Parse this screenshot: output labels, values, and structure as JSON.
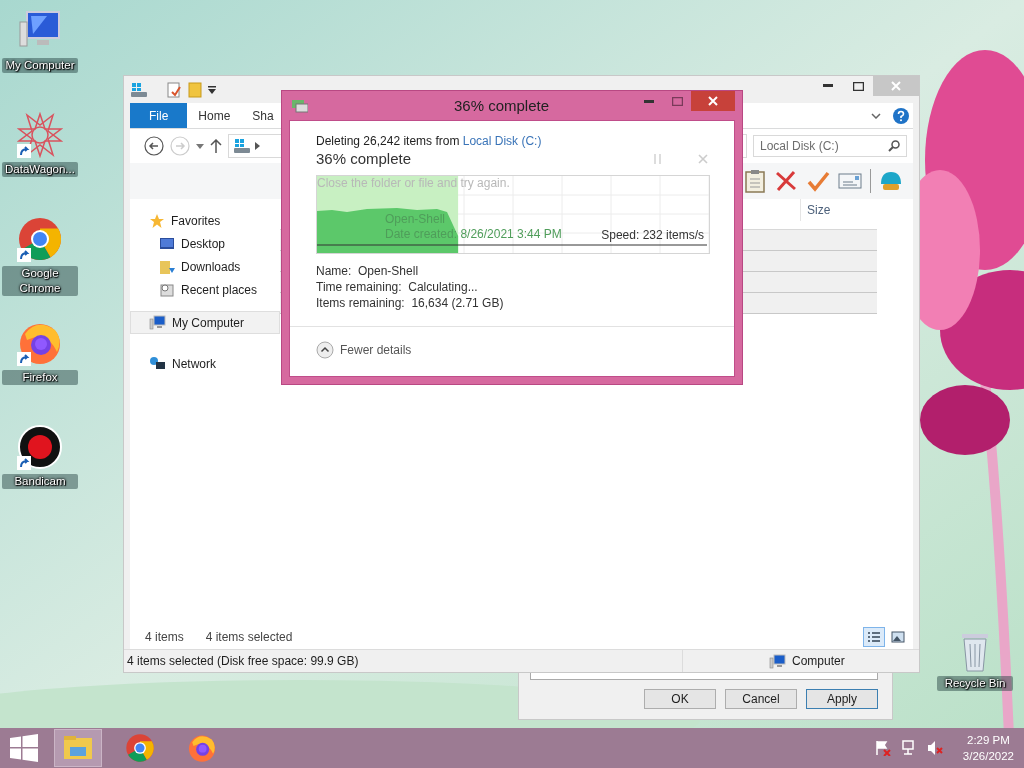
{
  "desktop_icons": [
    {
      "label": "My Computer",
      "kind": "computer",
      "shortcut": false
    },
    {
      "label": "DataWagon...",
      "kind": "star",
      "shortcut": true
    },
    {
      "label": "Google Chrome",
      "kind": "chrome",
      "shortcut": true
    },
    {
      "label": "Firefox",
      "kind": "firefox",
      "shortcut": true
    },
    {
      "label": "Bandicam",
      "kind": "record",
      "shortcut": true
    }
  ],
  "recycle_bin": {
    "label": "Recycle Bin"
  },
  "explorer": {
    "ribbon_tabs": [
      {
        "label": "File",
        "selected": true
      },
      {
        "label": "Home",
        "selected": false
      },
      {
        "label": "Sha",
        "selected": false
      }
    ],
    "search": {
      "placeholder": "Local Disk (C:)"
    },
    "nav": [
      {
        "label": "Favorites",
        "kind": "favorites",
        "selected": false,
        "children": [
          {
            "label": "Desktop",
            "kind": "desktop",
            "selected": false
          },
          {
            "label": "Downloads",
            "kind": "downloads",
            "selected": false
          },
          {
            "label": "Recent places",
            "kind": "recent",
            "selected": false
          }
        ]
      },
      {
        "label": "My Computer",
        "kind": "computer",
        "selected": true
      },
      {
        "label": "Network",
        "kind": "network",
        "selected": false
      }
    ],
    "columns": [
      "Size"
    ],
    "rows": [
      {
        "selected": true
      },
      {
        "selected": true
      },
      {
        "selected": true
      },
      {
        "selected": true
      }
    ],
    "footer": {
      "count": "4 items",
      "selection": "4 items selected"
    },
    "view_buttons": [
      {
        "kind": "details",
        "selected": true
      },
      {
        "kind": "tiles",
        "selected": false
      }
    ],
    "status_bar": {
      "text": "4 items selected (Disk free space: 99.9 GB)",
      "location": "Computer"
    }
  },
  "properties_dialog": {
    "buttons": [
      {
        "label": "OK",
        "default": false
      },
      {
        "label": "Cancel",
        "default": false
      },
      {
        "label": "Apply",
        "default": true
      }
    ]
  },
  "progress_dialog": {
    "title": "36% complete",
    "summary": "Deleting 26,242 items from",
    "source": "Local Disk (C:)",
    "heading": "36% complete",
    "level": 0.36,
    "faded_message": "Close the folder or file and try again.",
    "item_name": "Open-Shell",
    "item_date": "Date created: 8/26/2021 3:44 PM",
    "speed": "Speed: 232 items/s",
    "details": [
      {
        "label": "Name:",
        "value": "Open-Shell"
      },
      {
        "label": "Time remaining:",
        "value": "Calculating..."
      },
      {
        "label": "Items remaining:",
        "value": "16,634 (2.71 GB)"
      }
    ],
    "toggle": "Fewer details"
  },
  "taskbar": {
    "apps": [
      {
        "kind": "explorer",
        "selected": true
      },
      {
        "kind": "chrome",
        "selected": false
      },
      {
        "kind": "firefox",
        "selected": false
      }
    ],
    "time": "2:29 PM",
    "date": "3/26/2022"
  }
}
